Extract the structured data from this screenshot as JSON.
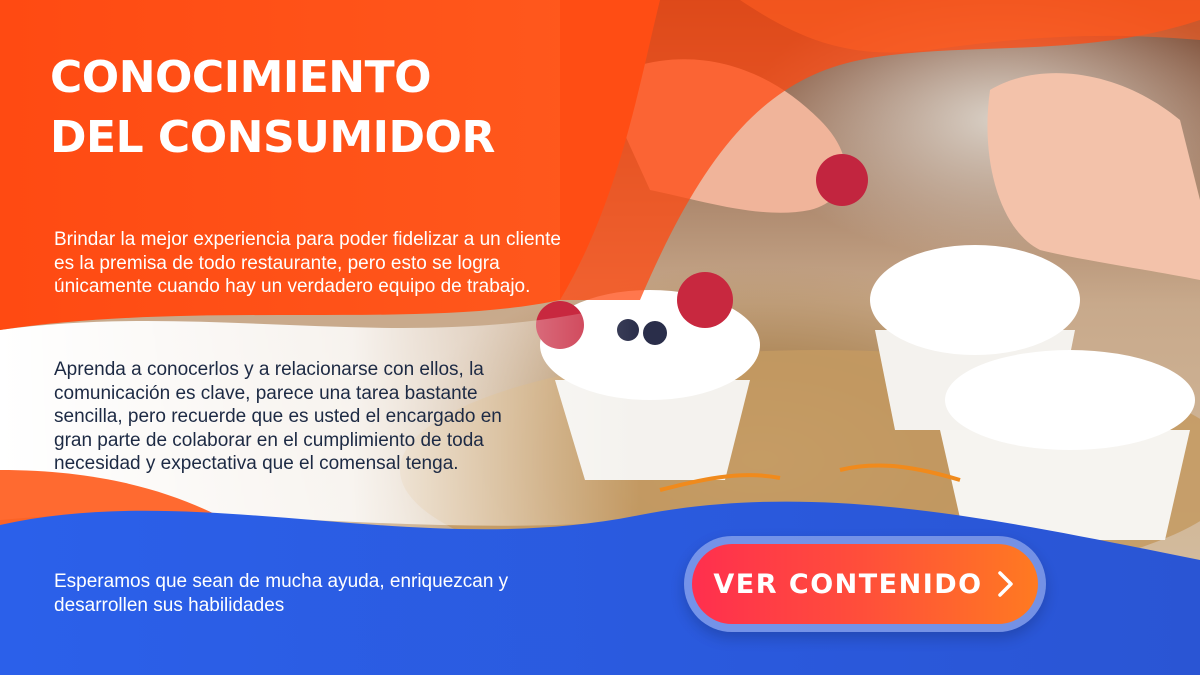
{
  "title": {
    "line1": "CONOCIMIENTO",
    "line2": "DEL CONSUMIDOR"
  },
  "paragraph1": "Brindar la mejor experiencia para poder fidelizar a un cliente es la premisa de todo restaurante, pero esto se logra únicamente cuando hay un verdadero equipo de trabajo.",
  "paragraph2": "Aprenda a conocerlos y a relacionarse con ellos, la comunicación es clave, parece una tarea bastante sencilla, pero recuerde que es usted el encargado en gran parte de colaborar en el cumplimiento de toda necesidad y expectativa que el comensal tenga.",
  "paragraph3": "Esperamos que sean de mucha ayuda, enriquezcan y desarrollen sus habilidades",
  "cta": {
    "label": "VER CONTENIDO",
    "icon": "chevron-right-icon"
  },
  "colors": {
    "orange": "#ff4a12",
    "blue": "#2b5fe0",
    "cta_start": "#ff2f4e",
    "cta_end": "#ff7a21"
  }
}
